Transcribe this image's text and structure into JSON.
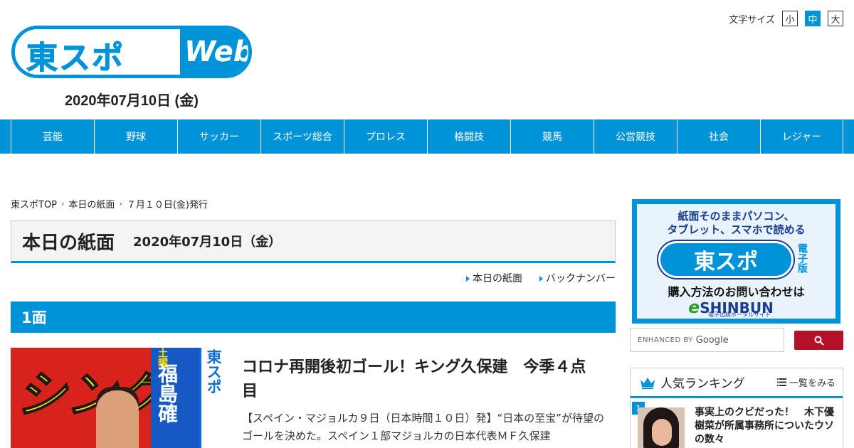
{
  "header": {
    "logo_text": "東スポ",
    "logo_web": "Web",
    "date": "2020年07月10日 (金)",
    "fontsize_label": "文字サイズ",
    "fontsize_options": [
      "小",
      "中",
      "大"
    ]
  },
  "nav": [
    "芸能",
    "野球",
    "サッカー",
    "スポーツ総合",
    "プロレス",
    "格闘技",
    "競馬",
    "公営競技",
    "社会",
    "レジャー"
  ],
  "breadcrumb": [
    "東スポTOP",
    "本日の紙面",
    "７月１０日(金)発行"
  ],
  "page_title": "本日の紙面",
  "page_date": "2020年07月10日（金）",
  "sublinks": [
    "本日の紙面",
    "バックナンバー"
  ],
  "section": "1面",
  "paper": {
    "headline": "シング",
    "side_text": "福島確",
    "side_small": "土曜",
    "brand": "東スポ"
  },
  "article": {
    "title": "コロナ再開後初ゴール！キング久保建　今季４点目",
    "body": "【スペイン・マジョルカ９日（日本時間１０日）発】“日本の至宝”が待望のゴールを決めた。スペイン１部マジョルカの日本代表ＭＦ久保建"
  },
  "ad": {
    "top_line1": "紙面そのままパソコン、",
    "top_line2": "タブレット、スマホで読める",
    "logo": "東スポ",
    "kind": "電子版",
    "line": "購入方法のお問い合わせは",
    "brand_e": "e",
    "brand": "SHINBUN",
    "sub": "電子出版ポータルサイト"
  },
  "search": {
    "enhanced": "ENHANCED BY",
    "google": "Google"
  },
  "ranking": {
    "title": "人気ランキング",
    "all_label": "一覧をみる",
    "items": [
      {
        "rank": "1",
        "text": "事実上のクビだった！　木下優樹菜が所属事務所についたウソの数々"
      }
    ]
  },
  "colors": {
    "accent": "#0093d8",
    "search_button": "#b3112a"
  }
}
